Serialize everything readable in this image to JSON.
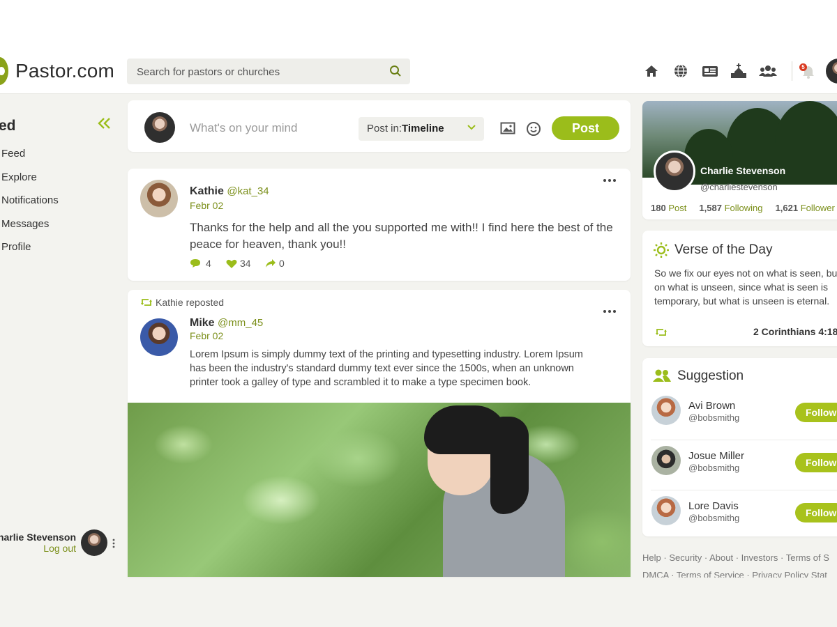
{
  "brand": {
    "name": "Pastor.com"
  },
  "search": {
    "placeholder": "Search for pastors or churches"
  },
  "nav": {
    "notification_count": "5"
  },
  "sidebar": {
    "heading": "ed",
    "items": [
      {
        "label": "Feed"
      },
      {
        "label": "Explore"
      },
      {
        "label": "Notifications"
      },
      {
        "label": "Messages"
      },
      {
        "label": "Profile"
      }
    ],
    "user_name": "harlie Stevenson",
    "logout": "Log out"
  },
  "composer": {
    "placeholder": "What's on your mind",
    "post_in_label": "Post in:",
    "post_in_value": "Timeline",
    "post_button": "Post"
  },
  "posts": [
    {
      "name": "Kathie",
      "handle": "@kat_34",
      "date": "Febr 02",
      "text": "Thanks for the help and all the you supported me with!! I find here the best of the peace for heaven, thank you!!",
      "comments": "4",
      "likes": "34",
      "shares": "0"
    },
    {
      "repost_by": "Kathie reposted",
      "name": "Mike",
      "handle": "@mm_45",
      "date": "Febr 02",
      "text": "Lorem Ipsum is simply dummy text of the printing and typesetting industry. Lorem Ipsum has been the industry's standard dummy text ever since the 1500s, when an unknown printer took a galley of type and scrambled it to make a type specimen book."
    }
  ],
  "profile_card": {
    "name": "Charlie Stevenson",
    "handle": "@charliestevenson",
    "posts": "180",
    "posts_label": "Post",
    "following": "1,587",
    "following_label": "Following",
    "followers": "1,621",
    "followers_label": "Follower"
  },
  "verse": {
    "title": "Verse of the Day",
    "text": "So we fix our eyes not on what is seen, but on what is unseen, since what is seen is temporary, but what is unseen is eternal.",
    "reference": "2 Corinthians 4:18"
  },
  "suggestion": {
    "title": "Suggestion",
    "follow_label": "Follow",
    "people": [
      {
        "name": "Avi Brown",
        "handle": "@bobsmithg"
      },
      {
        "name": "Josue Miller",
        "handle": "@bobsmithg"
      },
      {
        "name": "Lore Davis",
        "handle": "@bobsmithg"
      }
    ]
  },
  "footer": {
    "line1": [
      "Help",
      "Security",
      "About",
      "Investors",
      "Terms of S"
    ],
    "line2": [
      "DMCA",
      "Terms of Service",
      "Privacy Policy Stat"
    ]
  },
  "colors": {
    "accent": "#9bbd1b",
    "accent_text": "#7b8f1a",
    "background": "#f3f3ef"
  }
}
